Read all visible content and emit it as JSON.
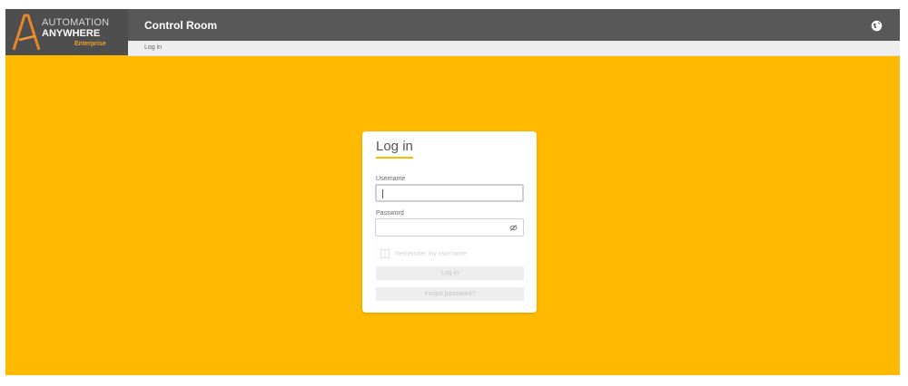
{
  "header": {
    "logo": {
      "line1": "AUTOMATION",
      "line2": "ANYWHERE",
      "line3": "Enterprise"
    },
    "app_title": "Control Room",
    "globe_icon": "globe-icon"
  },
  "breadcrumb": {
    "current": "Log in"
  },
  "login": {
    "title": "Log in",
    "username_label": "Username",
    "username_value": "",
    "password_label": "Password",
    "password_value": "",
    "show_password_icon": "eye-slash-icon",
    "remember_label": "Remember my username",
    "remember_checked": false,
    "login_button": "Log in",
    "forgot_button": "Forgot password?"
  },
  "colors": {
    "background": "#ffba00",
    "header": "#585858",
    "accent": "#ffba00"
  }
}
